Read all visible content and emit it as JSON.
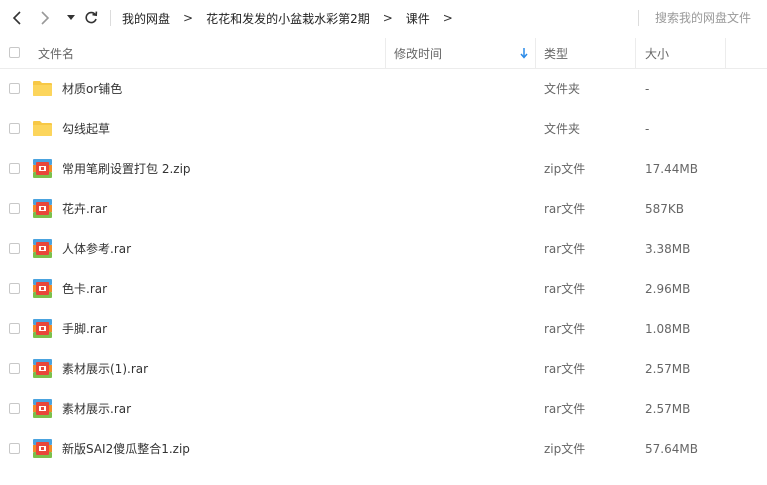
{
  "nav": {
    "back_icon": "chevron-left-icon",
    "forward_icon": "chevron-right-icon",
    "history_icon": "caret-down-icon",
    "refresh_icon": "refresh-icon"
  },
  "breadcrumb": {
    "items": [
      "我的网盘",
      "花花和发发的小盆栽水彩第2期",
      "课件"
    ],
    "separator": ">"
  },
  "search": {
    "placeholder": "搜索我的网盘文件"
  },
  "header": {
    "name": "文件名",
    "modified": "修改时间",
    "type": "类型",
    "size": "大小",
    "sort_icon": "arrow-down-icon",
    "sort_color": "#2b8ae8"
  },
  "files": [
    {
      "name": "材质or铺色",
      "type": "文件夹",
      "size": "-",
      "icon": "folder-icon"
    },
    {
      "name": "勾线起草",
      "type": "文件夹",
      "size": "-",
      "icon": "folder-icon"
    },
    {
      "name": "常用笔刷设置打包 2.zip",
      "type": "zip文件",
      "size": "17.44MB",
      "icon": "archive-icon"
    },
    {
      "name": "花卉.rar",
      "type": "rar文件",
      "size": "587KB",
      "icon": "archive-icon"
    },
    {
      "name": "人体参考.rar",
      "type": "rar文件",
      "size": "3.38MB",
      "icon": "archive-icon"
    },
    {
      "name": "色卡.rar",
      "type": "rar文件",
      "size": "2.96MB",
      "icon": "archive-icon"
    },
    {
      "name": "手脚.rar",
      "type": "rar文件",
      "size": "1.08MB",
      "icon": "archive-icon"
    },
    {
      "name": "素材展示(1).rar",
      "type": "rar文件",
      "size": "2.57MB",
      "icon": "archive-icon"
    },
    {
      "name": "素材展示.rar",
      "type": "rar文件",
      "size": "2.57MB",
      "icon": "archive-icon"
    },
    {
      "name": "新版SAI2傻瓜整合1.zip",
      "type": "zip文件",
      "size": "57.64MB",
      "icon": "archive-icon"
    }
  ],
  "colors": {
    "folder": "#f7c846",
    "archive_top": "#4aa3df",
    "archive_bottom": "#e8463a",
    "archive_middle": "#f28b28"
  }
}
